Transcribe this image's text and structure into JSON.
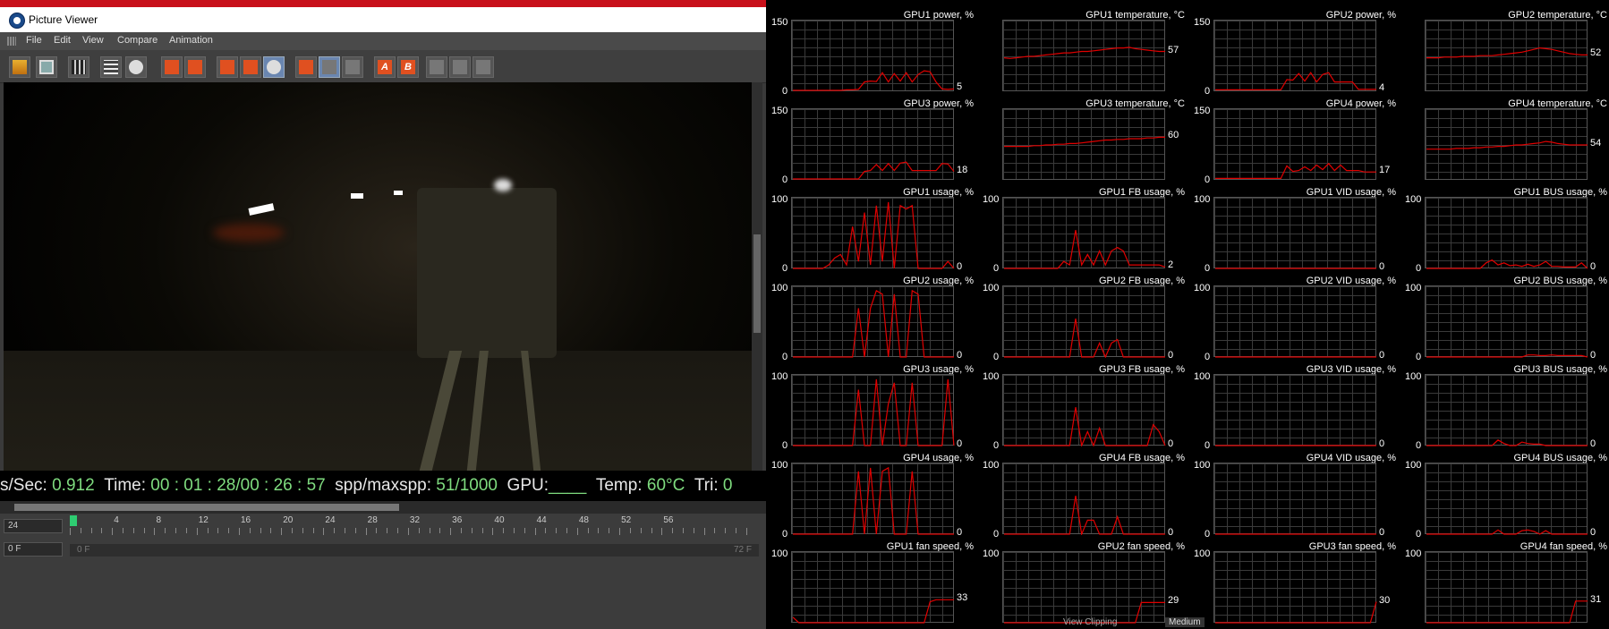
{
  "window": {
    "title": "Picture Viewer"
  },
  "menu": [
    "File",
    "Edit",
    "View",
    "Compare",
    "Animation"
  ],
  "stats": {
    "sps_label": "s/Sec:",
    "sps_value": "0.912",
    "time_label": "Time:",
    "time_value": "00 : 01 : 28/00 : 26 : 57",
    "spp_label": "spp/maxspp:",
    "spp_value": "51/1000",
    "gpu_label": "GPU:",
    "gpu_value": "____",
    "temp_label": "Temp:",
    "temp_value": "60°C",
    "tri_label": "Tri:",
    "tri_value": "0"
  },
  "timeline": {
    "fps": "24",
    "frame": "0 F",
    "range_start": "0 F",
    "range_end": "72 F",
    "ticks": [
      "0",
      "4",
      "8",
      "12",
      "16",
      "20",
      "24",
      "28",
      "32",
      "36",
      "40",
      "44",
      "48",
      "52",
      "56"
    ]
  },
  "monitor_footer": {
    "view_clipping": "View Clipping",
    "quality": "Medium"
  },
  "colors": {
    "series": "#e00000",
    "stats_value": "#7fdc7f"
  },
  "chart_data": [
    {
      "type": "line",
      "title": "GPU1 power, %",
      "ylim": [
        0,
        150
      ],
      "ytick_labels": [
        "150",
        "0"
      ],
      "current": "5",
      "values": [
        2,
        2,
        2,
        2,
        2,
        2,
        2,
        2,
        2,
        3,
        3,
        4,
        20,
        22,
        21,
        40,
        20,
        38,
        22,
        40,
        20,
        36,
        44,
        42,
        20,
        5,
        4,
        5
      ]
    },
    {
      "type": "line",
      "title": "GPU1 temperature, °C",
      "ylim": [
        0,
        100
      ],
      "ytick_labels": [
        "",
        ""
      ],
      "current": "57",
      "values": [
        48,
        47,
        48,
        49,
        50,
        50,
        51,
        52,
        53,
        54,
        55,
        55,
        56,
        57,
        57,
        58,
        59,
        60,
        61,
        62,
        62,
        63,
        61,
        60,
        59,
        58,
        57,
        57
      ]
    },
    {
      "type": "line",
      "title": "GPU2 power, %",
      "ylim": [
        0,
        150
      ],
      "ytick_labels": [
        "150",
        "0"
      ],
      "current": "4",
      "values": [
        3,
        3,
        3,
        3,
        3,
        3,
        3,
        3,
        3,
        3,
        3,
        3,
        25,
        24,
        38,
        22,
        40,
        20,
        36,
        40,
        20,
        20,
        20,
        20,
        4,
        4,
        4,
        4
      ]
    },
    {
      "type": "line",
      "title": "GPU2 temperature, °C",
      "ylim": [
        0,
        100
      ],
      "ytick_labels": [
        "",
        ""
      ],
      "current": "52",
      "values": [
        48,
        48,
        48,
        49,
        49,
        49,
        50,
        50,
        50,
        51,
        51,
        51,
        52,
        53,
        54,
        55,
        56,
        58,
        60,
        62,
        61,
        60,
        58,
        56,
        54,
        53,
        52,
        52
      ]
    },
    {
      "type": "line",
      "title": "GPU3 power, %",
      "ylim": [
        0,
        150
      ],
      "ytick_labels": [
        "150",
        "0"
      ],
      "current": "18",
      "values": [
        2,
        2,
        2,
        2,
        2,
        2,
        2,
        2,
        2,
        2,
        2,
        2,
        18,
        20,
        33,
        20,
        35,
        20,
        36,
        38,
        20,
        20,
        20,
        20,
        20,
        35,
        34,
        18
      ]
    },
    {
      "type": "line",
      "title": "GPU3 temperature, °C",
      "ylim": [
        0,
        100
      ],
      "ytick_labels": [
        "",
        ""
      ],
      "current": "60",
      "values": [
        48,
        48,
        48,
        48,
        48,
        49,
        49,
        50,
        50,
        51,
        51,
        52,
        52,
        53,
        54,
        55,
        56,
        57,
        57,
        58,
        58,
        59,
        59,
        59,
        60,
        60,
        61,
        61
      ]
    },
    {
      "type": "line",
      "title": "GPU4 power, %",
      "ylim": [
        0,
        150
      ],
      "ytick_labels": [
        "150",
        "0"
      ],
      "current": "17",
      "values": [
        3,
        3,
        3,
        3,
        3,
        3,
        3,
        3,
        3,
        3,
        3,
        3,
        30,
        18,
        20,
        28,
        20,
        32,
        22,
        35,
        20,
        32,
        20,
        20,
        20,
        17,
        17,
        17
      ]
    },
    {
      "type": "line",
      "title": "GPU4 temperature, °C",
      "ylim": [
        0,
        100
      ],
      "ytick_labels": [
        "",
        ""
      ],
      "current": "54",
      "values": [
        44,
        44,
        44,
        44,
        44,
        45,
        45,
        45,
        46,
        46,
        47,
        47,
        48,
        48,
        49,
        50,
        50,
        51,
        52,
        53,
        55,
        54,
        52,
        51,
        50,
        50,
        50,
        50
      ]
    },
    {
      "type": "line",
      "title": "GPU1 usage, %",
      "ylim": [
        0,
        100
      ],
      "ytick_labels": [
        "100",
        "0"
      ],
      "current": "0",
      "values": [
        0,
        0,
        0,
        0,
        0,
        0,
        5,
        15,
        20,
        5,
        60,
        10,
        80,
        5,
        90,
        10,
        95,
        0,
        90,
        85,
        90,
        0,
        0,
        0,
        0,
        0,
        10,
        0
      ]
    },
    {
      "type": "line",
      "title": "GPU1 FB usage, %",
      "ylim": [
        0,
        100
      ],
      "ytick_labels": [
        "100",
        "0"
      ],
      "current": "2",
      "values": [
        0,
        0,
        0,
        0,
        0,
        0,
        0,
        0,
        0,
        0,
        10,
        5,
        55,
        5,
        20,
        5,
        25,
        5,
        25,
        30,
        25,
        5,
        5,
        5,
        5,
        5,
        5,
        2
      ]
    },
    {
      "type": "line",
      "title": "GPU1 VID usage, %",
      "ylim": [
        0,
        100
      ],
      "ytick_labels": [
        "100",
        "0"
      ],
      "current": "0",
      "values": [
        0,
        0,
        0,
        0,
        0,
        0,
        0,
        0,
        0,
        0,
        0,
        0,
        0,
        0,
        0,
        0,
        0,
        0,
        0,
        0,
        0,
        0,
        0,
        0,
        0,
        0,
        0,
        0
      ]
    },
    {
      "type": "line",
      "title": "GPU1 BUS usage, %",
      "ylim": [
        0,
        100
      ],
      "ytick_labels": [
        "100",
        "0"
      ],
      "current": "0",
      "values": [
        0,
        0,
        0,
        0,
        0,
        0,
        0,
        0,
        0,
        0,
        8,
        12,
        5,
        8,
        4,
        5,
        3,
        6,
        3,
        5,
        10,
        3,
        3,
        2,
        2,
        2,
        8,
        0
      ]
    },
    {
      "type": "line",
      "title": "GPU2 usage, %",
      "ylim": [
        0,
        100
      ],
      "ytick_labels": [
        "100",
        "0"
      ],
      "current": "0",
      "values": [
        0,
        0,
        0,
        0,
        0,
        0,
        0,
        0,
        0,
        0,
        0,
        70,
        0,
        70,
        95,
        90,
        0,
        90,
        0,
        0,
        95,
        90,
        0,
        0,
        0,
        0,
        0,
        0
      ]
    },
    {
      "type": "line",
      "title": "GPU2 FB usage, %",
      "ylim": [
        0,
        100
      ],
      "ytick_labels": [
        "100",
        "0"
      ],
      "current": "0",
      "values": [
        0,
        0,
        0,
        0,
        0,
        0,
        0,
        0,
        0,
        0,
        0,
        0,
        55,
        0,
        0,
        0,
        20,
        0,
        20,
        25,
        0,
        0,
        0,
        0,
        0,
        0,
        0,
        0
      ]
    },
    {
      "type": "line",
      "title": "GPU2 VID usage, %",
      "ylim": [
        0,
        100
      ],
      "ytick_labels": [
        "100",
        "0"
      ],
      "current": "0",
      "values": [
        0,
        0,
        0,
        0,
        0,
        0,
        0,
        0,
        0,
        0,
        0,
        0,
        0,
        0,
        0,
        0,
        0,
        0,
        0,
        0,
        0,
        0,
        0,
        0,
        0,
        0,
        0,
        0
      ]
    },
    {
      "type": "line",
      "title": "GPU2 BUS usage, %",
      "ylim": [
        0,
        100
      ],
      "ytick_labels": [
        "100",
        "0"
      ],
      "current": "0",
      "values": [
        0,
        0,
        0,
        0,
        0,
        0,
        0,
        0,
        0,
        0,
        0,
        0,
        0,
        0,
        0,
        0,
        0,
        3,
        3,
        2,
        2,
        3,
        2,
        2,
        2,
        2,
        2,
        0
      ]
    },
    {
      "type": "line",
      "title": "GPU3 usage, %",
      "ylim": [
        0,
        100
      ],
      "ytick_labels": [
        "100",
        "0"
      ],
      "current": "0",
      "values": [
        0,
        0,
        0,
        0,
        0,
        0,
        0,
        0,
        0,
        0,
        0,
        80,
        0,
        0,
        95,
        0,
        60,
        90,
        0,
        0,
        90,
        0,
        0,
        0,
        0,
        0,
        95,
        0
      ]
    },
    {
      "type": "line",
      "title": "GPU3 FB usage, %",
      "ylim": [
        0,
        100
      ],
      "ytick_labels": [
        "100",
        "0"
      ],
      "current": "0",
      "values": [
        0,
        0,
        0,
        0,
        0,
        0,
        0,
        0,
        0,
        0,
        0,
        0,
        55,
        0,
        20,
        0,
        25,
        0,
        0,
        0,
        0,
        0,
        0,
        0,
        0,
        30,
        20,
        0
      ]
    },
    {
      "type": "line",
      "title": "GPU3 VID usage, %",
      "ylim": [
        0,
        100
      ],
      "ytick_labels": [
        "100",
        "0"
      ],
      "current": "0",
      "values": [
        0,
        0,
        0,
        0,
        0,
        0,
        0,
        0,
        0,
        0,
        0,
        0,
        0,
        0,
        0,
        0,
        0,
        0,
        0,
        0,
        0,
        0,
        0,
        0,
        0,
        0,
        0,
        0
      ]
    },
    {
      "type": "line",
      "title": "GPU3 BUS usage, %",
      "ylim": [
        0,
        100
      ],
      "ytick_labels": [
        "100",
        "0"
      ],
      "current": "0",
      "values": [
        0,
        0,
        0,
        0,
        0,
        0,
        0,
        0,
        0,
        0,
        0,
        0,
        8,
        3,
        0,
        0,
        5,
        3,
        2,
        2,
        0,
        0,
        0,
        0,
        0,
        0,
        0,
        0
      ]
    },
    {
      "type": "line",
      "title": "GPU4 usage, %",
      "ylim": [
        0,
        100
      ],
      "ytick_labels": [
        "100",
        "0"
      ],
      "current": "0",
      "values": [
        0,
        0,
        0,
        0,
        0,
        0,
        0,
        0,
        0,
        0,
        0,
        90,
        0,
        95,
        0,
        90,
        95,
        0,
        0,
        0,
        90,
        0,
        0,
        0,
        0,
        0,
        0,
        0
      ]
    },
    {
      "type": "line",
      "title": "GPU4 FB usage, %",
      "ylim": [
        0,
        100
      ],
      "ytick_labels": [
        "100",
        "0"
      ],
      "current": "0",
      "values": [
        0,
        0,
        0,
        0,
        0,
        0,
        0,
        0,
        0,
        0,
        0,
        0,
        55,
        0,
        20,
        20,
        0,
        0,
        0,
        25,
        0,
        0,
        0,
        0,
        0,
        0,
        0,
        0
      ]
    },
    {
      "type": "line",
      "title": "GPU4 VID usage, %",
      "ylim": [
        0,
        100
      ],
      "ytick_labels": [
        "100",
        "0"
      ],
      "current": "0",
      "values": [
        0,
        0,
        0,
        0,
        0,
        0,
        0,
        0,
        0,
        0,
        0,
        0,
        0,
        0,
        0,
        0,
        0,
        0,
        0,
        0,
        0,
        0,
        0,
        0,
        0,
        0,
        0,
        0
      ]
    },
    {
      "type": "line",
      "title": "GPU4 BUS usage, %",
      "ylim": [
        0,
        100
      ],
      "ytick_labels": [
        "100",
        "0"
      ],
      "current": "0",
      "values": [
        0,
        0,
        0,
        0,
        0,
        0,
        0,
        0,
        0,
        0,
        0,
        0,
        6,
        0,
        0,
        0,
        5,
        6,
        4,
        0,
        5,
        0,
        0,
        0,
        0,
        0,
        0,
        0
      ]
    },
    {
      "type": "line",
      "title": "GPU1 fan speed, %",
      "ylim": [
        0,
        100
      ],
      "ytick_labels": [
        "100",
        ""
      ],
      "current": "33",
      "values": [
        8,
        0,
        0,
        0,
        0,
        0,
        0,
        0,
        0,
        0,
        0,
        0,
        0,
        0,
        0,
        0,
        0,
        0,
        0,
        0,
        0,
        0,
        0,
        30,
        33,
        33,
        33,
        33
      ]
    },
    {
      "type": "line",
      "title": "GPU2 fan speed, %",
      "ylim": [
        0,
        100
      ],
      "ytick_labels": [
        "100",
        ""
      ],
      "current": "29",
      "values": [
        0,
        0,
        0,
        0,
        0,
        0,
        0,
        0,
        0,
        0,
        0,
        0,
        0,
        0,
        0,
        0,
        0,
        0,
        0,
        0,
        0,
        0,
        0,
        29,
        29,
        29,
        29,
        29
      ]
    },
    {
      "type": "line",
      "title": "GPU3 fan speed, %",
      "ylim": [
        0,
        100
      ],
      "ytick_labels": [
        "100",
        ""
      ],
      "current": "30",
      "values": [
        0,
        0,
        0,
        0,
        0,
        0,
        0,
        0,
        0,
        0,
        0,
        0,
        0,
        0,
        0,
        0,
        0,
        0,
        0,
        0,
        0,
        0,
        0,
        0,
        0,
        0,
        0,
        30
      ]
    },
    {
      "type": "line",
      "title": "GPU4 fan speed, %",
      "ylim": [
        0,
        100
      ],
      "ytick_labels": [
        "100",
        ""
      ],
      "current": "31",
      "values": [
        0,
        0,
        0,
        0,
        0,
        0,
        0,
        0,
        0,
        0,
        0,
        0,
        0,
        0,
        0,
        0,
        0,
        0,
        0,
        0,
        0,
        0,
        0,
        0,
        0,
        31,
        31,
        31
      ]
    }
  ]
}
